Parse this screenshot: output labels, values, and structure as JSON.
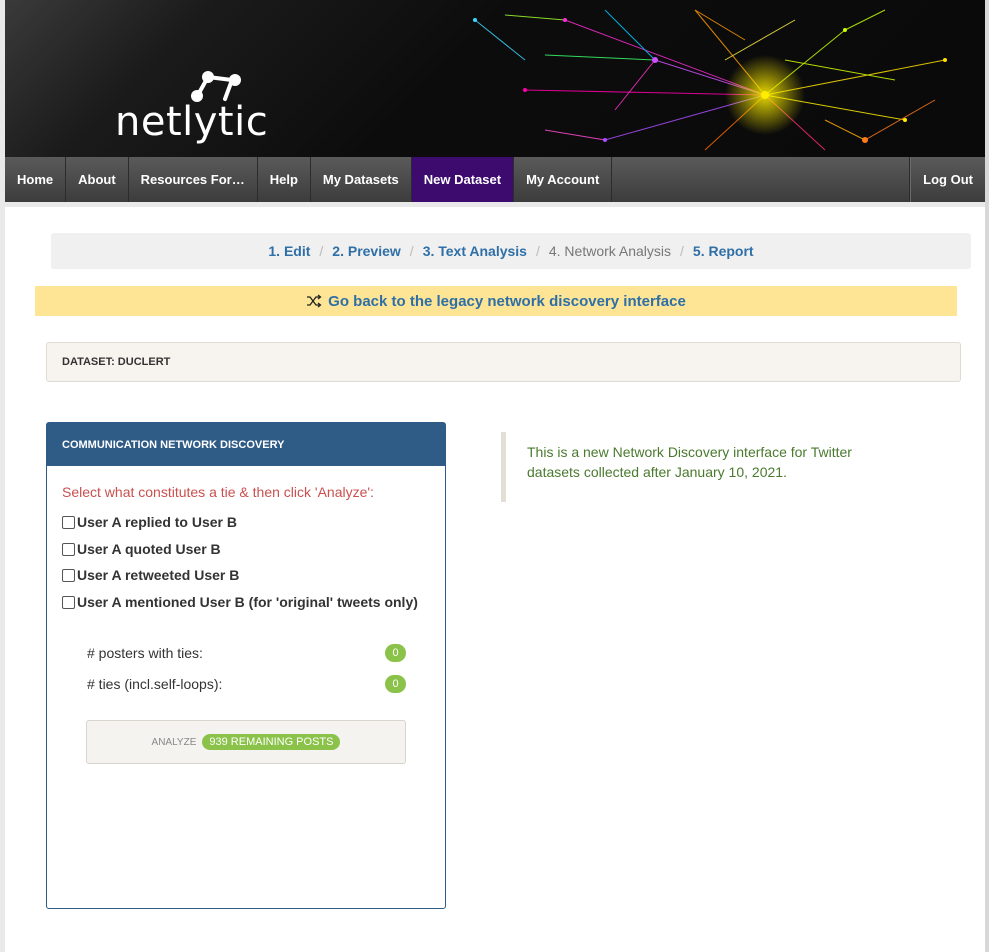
{
  "logo": {
    "text": "netlytic"
  },
  "nav": {
    "items": [
      "Home",
      "About",
      "Resources For…",
      "Help",
      "My Datasets",
      "New Dataset",
      "My Account"
    ],
    "active": "New Dataset",
    "logout": "Log Out"
  },
  "steps": [
    {
      "label": "1. Edit",
      "current": false
    },
    {
      "label": "2. Preview",
      "current": false
    },
    {
      "label": "3. Text Analysis",
      "current": false
    },
    {
      "label": "4. Network Analysis",
      "current": true
    },
    {
      "label": "5. Report",
      "current": false
    }
  ],
  "legacy": {
    "icon": "shuffle-icon",
    "label": "Go back to the legacy network discovery interface"
  },
  "dataset": {
    "label": "DATASET: DUCLERT"
  },
  "panel": {
    "title": "COMMUNICATION NETWORK DISCOVERY",
    "instruction": "Select what constitutes a tie & then click 'Analyze':",
    "options": [
      "User A replied to User B",
      "User A quoted User B",
      "User A retweeted User B",
      "User A mentioned User B (for 'original' tweets only)"
    ],
    "stats": [
      {
        "label": "# posters with ties:",
        "value": "0"
      },
      {
        "label": "# ties (incl.self-loops):",
        "value": "0"
      }
    ],
    "analyze": {
      "label": "ANALYZE",
      "remaining": "939 REMAINING POSTS"
    }
  },
  "note": "This is a new Network Discovery interface for Twitter datasets collected after January 10, 2021.",
  "colors": {
    "nav_active": "#3d0a6e",
    "panel_head": "#2f5b87",
    "badge": "#8bc34a",
    "link": "#2f6fa7",
    "legacy_bg": "#fde595"
  }
}
